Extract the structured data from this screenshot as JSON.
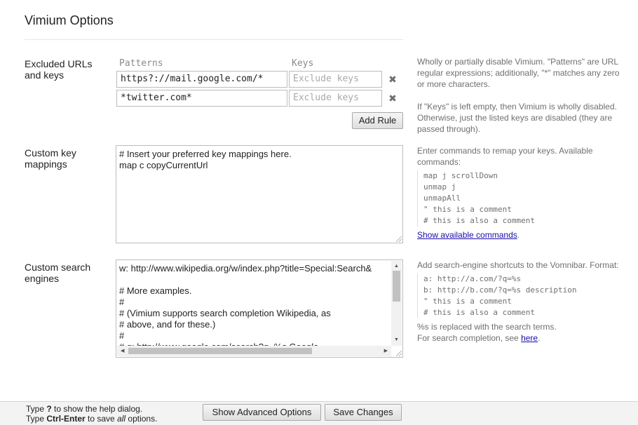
{
  "page": {
    "title": "Vimium Options"
  },
  "excluded": {
    "label": "Excluded URLs and keys",
    "patterns_header": "Patterns",
    "keys_header": "Keys",
    "rules": [
      {
        "pattern": "https?://mail.google.com/*",
        "keys": "",
        "keys_placeholder": "Exclude keys",
        "remove_icon": "✖"
      },
      {
        "pattern": "*twitter.com*",
        "keys": "",
        "keys_placeholder": "Exclude keys",
        "remove_icon": "✖"
      }
    ],
    "add_rule_label": "Add Rule",
    "help_1": "Wholly or partially disable Vimium. \"Patterns\" are URL regular expressions; additionally, \"*\" matches any zero or more characters.",
    "help_2": "If \"Keys\" is left empty, then Vimium is wholly disabled. Otherwise, just the listed keys are disabled (they are passed through)."
  },
  "key_mappings": {
    "label": "Custom key mappings",
    "lines": [
      "# Insert your preferred key mappings here.",
      "map c copyCurrentUrl"
    ],
    "help_intro": "Enter commands to remap your keys. Available commands:",
    "code_lines": [
      "map j scrollDown",
      "unmap j",
      "unmapAll",
      "\" this is a comment",
      "# this is also a comment"
    ],
    "link_label": "Show available commands",
    "link_suffix": "."
  },
  "search_engines": {
    "label": "Custom search engines",
    "lines": [
      "w: http://www.wikipedia.org/w/index.php?title=Special:Search&",
      "",
      "# More examples.",
      "#",
      "# (Vimium supports search completion Wikipedia, as",
      "# above, and for these.)",
      "#",
      "# g: http://www.google.com/search?q=%s Google"
    ],
    "help_intro": "Add search-engine shortcuts to the Vomnibar. Format:",
    "code_lines": [
      "a: http://a.com/?q=%s",
      "b: http://b.com/?q=%s description",
      "\" this is a comment",
      "# this is also a comment"
    ],
    "help_after_1": "%s is replaced with the search terms.",
    "help_after_2_prefix": "For search completion, see ",
    "help_link": "here",
    "help_after_2_suffix": "."
  },
  "footer": {
    "line1_prefix": "Type ",
    "line1_key": "?",
    "line1_suffix": " to show the help dialog.",
    "line2_prefix": "Type ",
    "line2_key": "Ctrl-Enter",
    "line2_mid": " to save ",
    "line2_em": "all",
    "line2_suffix": " options.",
    "advanced_label": "Show Advanced Options",
    "save_label": "Save Changes"
  },
  "scroll_icons": {
    "up": "▲",
    "down": "▼",
    "left": "◀",
    "right": "▶"
  }
}
